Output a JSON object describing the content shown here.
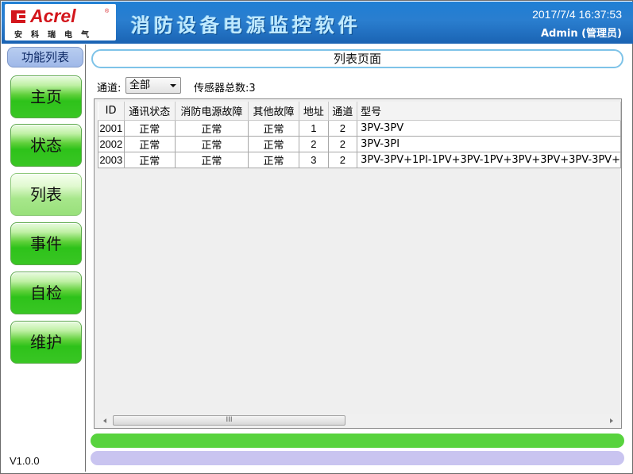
{
  "brand": {
    "logo_text": "Acrel",
    "logo_reg": "®",
    "logo_cn": "安科瑞电气",
    "logo_color": "#d3161c"
  },
  "app_title": "消防设备电源监控软件",
  "datetime": "2017/7/4 16:37:53",
  "user": "Admin (管理员)",
  "sidebar": {
    "title": "功能列表",
    "items": [
      {
        "label": "主页"
      },
      {
        "label": "状态"
      },
      {
        "label": "列表",
        "active": true
      },
      {
        "label": "事件"
      },
      {
        "label": "自检"
      },
      {
        "label": "维护"
      }
    ],
    "version": "V1.0.0"
  },
  "page_title": "列表页面",
  "filter": {
    "channel_label": "通道:",
    "channel_value": "全部",
    "sensor_total": "传感器总数:3"
  },
  "table": {
    "columns": [
      "ID",
      "通讯状态",
      "消防电源故障",
      "其他故障",
      "地址",
      "通道",
      "型号"
    ],
    "rows": [
      [
        "2001",
        "正常",
        "正常",
        "正常",
        "1",
        "2",
        "3PV-3PV"
      ],
      [
        "2002",
        "正常",
        "正常",
        "正常",
        "2",
        "2",
        "3PV-3PI"
      ],
      [
        "2003",
        "正常",
        "正常",
        "正常",
        "3",
        "2",
        "3PV-3PV+1PI-1PV+3PV-1PV+3PV+3PV+3PV-3PV+"
      ]
    ]
  },
  "scrollbar_thumb_label": "III",
  "colors": {
    "header_blue": "#1f7fd4",
    "nav_green": "#2ec21a",
    "status_green": "#58d33e",
    "status_lavender": "#c9c4f0"
  }
}
